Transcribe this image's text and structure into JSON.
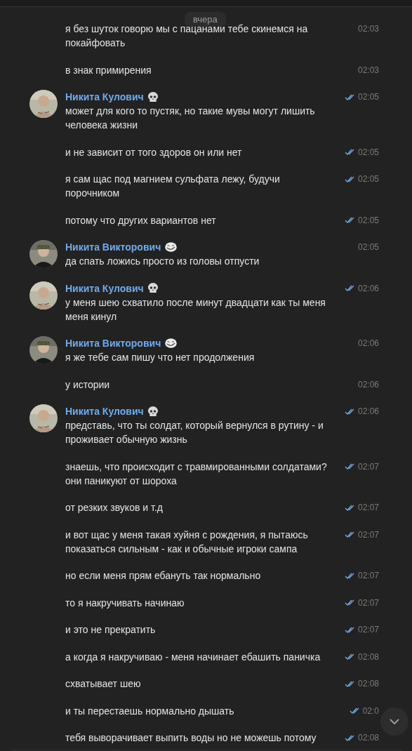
{
  "date_badge": "вчера",
  "messages": [
    {
      "text": "я без шуток говорю мы с пацанами тебе скинемся на покайфовать",
      "time": "02:03",
      "read": false
    },
    {
      "text": "в знак примирения",
      "time": "02:03",
      "read": false
    },
    {
      "author": "Никита Кулович",
      "kind": "own",
      "text": "может для кого то пустяк, но такие мувы могут лишить человека жизни",
      "time": "02:05",
      "read": true
    },
    {
      "text": "и не зависит от того здоров он или нет",
      "time": "02:05",
      "read": true
    },
    {
      "text": "я сам щас под магнием сульфата лежу, будучи порочником",
      "time": "02:05",
      "read": true
    },
    {
      "text": "потому что других вариантов нет",
      "time": "02:05",
      "read": true
    },
    {
      "author": "Никита Викторович",
      "kind": "peer",
      "text": "да спать ложись просто из головы отпусти",
      "time": "02:05",
      "read": false
    },
    {
      "author": "Никита Кулович",
      "kind": "own",
      "text": "у меня шею схватило после минут двадцати как ты меня меня кинул",
      "time": "02:06",
      "read": true
    },
    {
      "author": "Никита Викторович",
      "kind": "peer",
      "text": "я же тебе сам пишу что нет продолжения",
      "time": "02:06",
      "read": false
    },
    {
      "text": "у истории",
      "time": "02:06",
      "read": false
    },
    {
      "author": "Никита Кулович",
      "kind": "own",
      "text": "представь, что ты солдат, который вернулся в рутину - и проживает обычную жизнь",
      "time": "02:06",
      "read": true
    },
    {
      "text": "знаешь, что происходит с травмированными солдатами? они паникуют от шороха",
      "time": "02:07",
      "read": true
    },
    {
      "text": "от резких звуков и т.д",
      "time": "02:07",
      "read": true
    },
    {
      "text": "и вот щас у меня такая хуйня с рождения, я пытаюсь показаться сильным - как и обычные игроки сампа",
      "time": "02:07",
      "read": true
    },
    {
      "text": "но если меня прям ебануть так нормально",
      "time": "02:07",
      "read": true
    },
    {
      "text": "то я накручивать начинаю",
      "time": "02:07",
      "read": true
    },
    {
      "text": "и это не прекратить",
      "time": "02:07",
      "read": true
    },
    {
      "text": "а когда я накручиваю - меня начинает ебашить паничка",
      "time": "02:08",
      "read": true
    },
    {
      "text": "схватывает шею",
      "time": "02:08",
      "read": true
    },
    {
      "text": "и ты перестаешь нормально дышать",
      "time": "02:0",
      "read": true
    },
    {
      "text": "тебя выворачивает выпить воды но не можешь потому",
      "time": "02:08",
      "read": true
    }
  ]
}
